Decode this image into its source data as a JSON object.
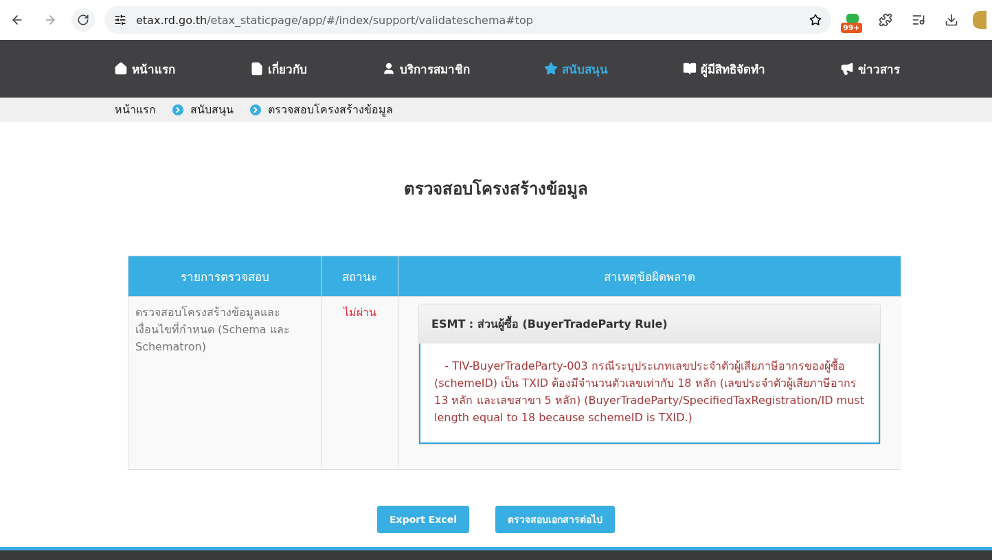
{
  "browser": {
    "url_host": "etax.rd.go.th",
    "url_path": "/etax_staticpage/app/#/index/support/validateschema#top",
    "extension_badge": "99+"
  },
  "nav": [
    {
      "label": "หน้าแรก",
      "selected": false
    },
    {
      "label": "เกี่ยวกับ",
      "selected": false
    },
    {
      "label": "บริการสมาชิก",
      "selected": false
    },
    {
      "label": "สนับสนุน",
      "selected": true
    },
    {
      "label": "ผู้มีสิทธิจัดทำ",
      "selected": false
    },
    {
      "label": "ข่าวสาร",
      "selected": false
    }
  ],
  "breadcrumb": [
    "หน้าแรก",
    "สนับสนุน",
    "ตรวจสอบโครงสร้างข้อมูล"
  ],
  "title": "ตรวจสอบโครงสร้างข้อมูล",
  "table": {
    "columns": [
      "รายการตรวจสอบ",
      "สถานะ",
      "สาเหตุข้อผิดพลาด"
    ],
    "rows": [
      {
        "item": "ตรวจสอบโครงสร้างข้อมูลและเงื่อนไขที่กำหนด (Schema และ Schematron)",
        "status": "ไม่ผ่าน",
        "passed": false,
        "panel": {
          "heading": "ESMT : ส่วนผู้ซื้อ (BuyerTradeParty Rule)",
          "message": "- TIV-BuyerTradeParty-003 กรณีระบุประเภทเลขประจำตัวผู้เสียภาษีอากรของผู้ซื้อ (schemeID) เป็น TXID ต้องมีจำนวนตัวเลขเท่ากับ 18 หลัก (เลขประจำตัวผู้เสียภาษีอากร 13 หลัก และเลขสาขา 5 หลัก) (BuyerTradeParty/SpecifiedTaxRegistration/ID must length equal to 18 because schemeID is TXID.)"
        }
      }
    ]
  },
  "buttons": [
    "Export Excel",
    "ตรวจสอบเอกสารต่อไป"
  ]
}
